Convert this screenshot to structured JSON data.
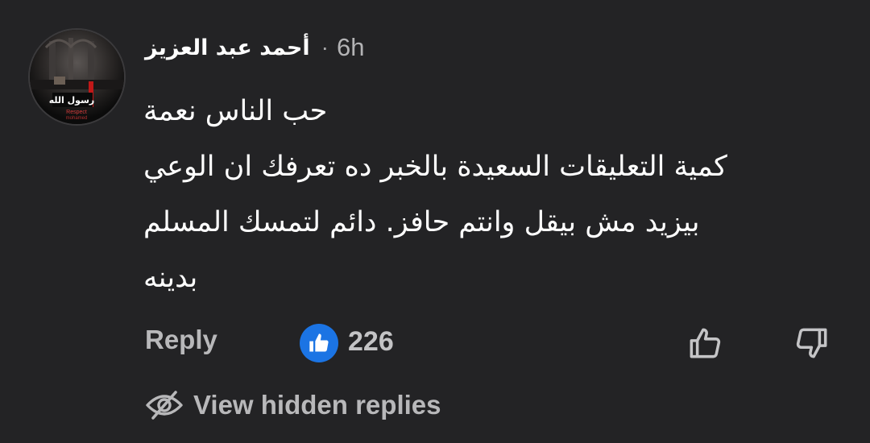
{
  "comment": {
    "author": "أحمد عبد العزيز",
    "separator": "·",
    "timestamp": "6h",
    "avatar": {
      "icon": "profile-photo",
      "banner_text": "رسول الله",
      "caption_lines": [
        "Respect",
        "mohamed"
      ]
    },
    "lines": [
      "حب الناس نعمة",
      "كمية التعليقات السعيدة بالخبر ده تعرفك ان الوعي",
      "بيزيد مش بيقل وانتم حافز. دائم لتمسك المسلم",
      "بدينه"
    ]
  },
  "actions": {
    "reply_label": "Reply",
    "reaction_icon": "thumbs-up-badge",
    "reaction_color": "#1b74e4",
    "like_count": "226",
    "upvote_icon": "thumbs-up-outline",
    "downvote_icon": "thumbs-down-outline"
  },
  "hidden_replies": {
    "icon": "eye-slash",
    "label": "View hidden replies"
  },
  "colors": {
    "background": "#232325",
    "text_primary": "#ffffff",
    "text_secondary": "#b8b8ba"
  }
}
